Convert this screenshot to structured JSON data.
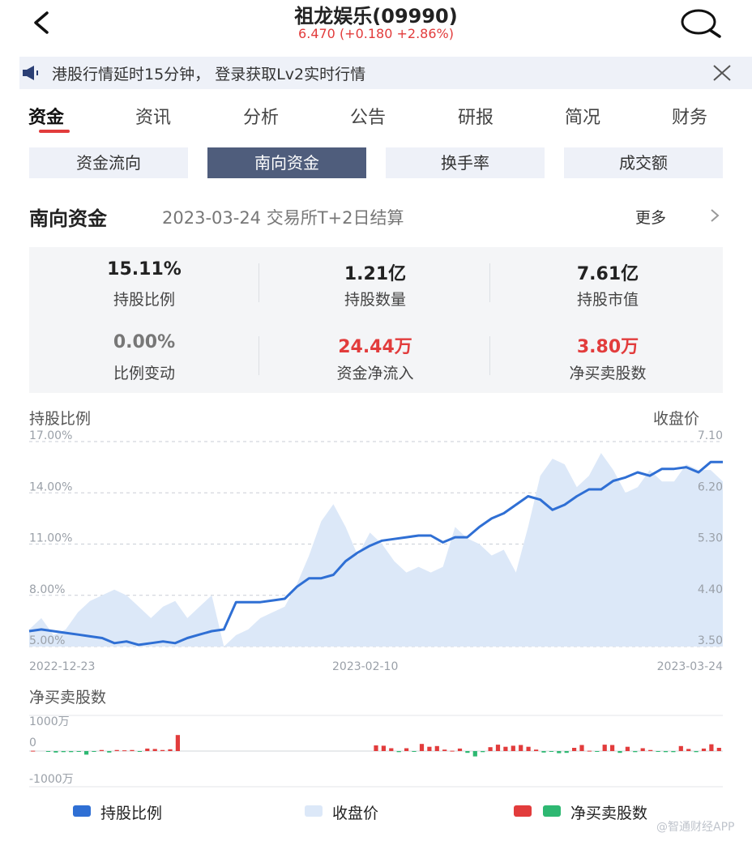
{
  "header": {
    "title": "祖龙娱乐(09990)",
    "quote": "6.470 (+0.180 +2.86%)"
  },
  "notice": {
    "text": "港股行情延时15分钟， 登录获取Lv2实时行情"
  },
  "tabs": [
    "资金",
    "资讯",
    "分析",
    "公告",
    "研报",
    "简况",
    "财务"
  ],
  "subtabs": [
    "资金流向",
    "南向资金",
    "换手率",
    "成交额"
  ],
  "section": {
    "title": "南向资金",
    "date": "2023-03-24 交易所T+2日结算",
    "more": "更多"
  },
  "stats": {
    "hold_ratio_value": "15.11%",
    "hold_ratio_label": "持股比例",
    "hold_qty_value": "1.21亿",
    "hold_qty_label": "持股数量",
    "hold_mv_value": "7.61亿",
    "hold_mv_label": "持股市值",
    "ratio_change_value": "0.00%",
    "ratio_change_label": "比例变动",
    "net_inflow_value": "24.44万",
    "net_inflow_label": "资金净流入",
    "net_shares_value": "3.80万",
    "net_shares_label": "净买卖股数"
  },
  "main_chart": {
    "left_title": "持股比例",
    "right_title": "收盘价",
    "left_ticks": [
      "17.00%",
      "14.00%",
      "11.00%",
      "8.00%",
      "5.00%"
    ],
    "right_ticks": [
      "7.10",
      "6.20",
      "5.30",
      "4.40",
      "3.50"
    ],
    "x_labels": [
      "2022-12-23",
      "2023-02-10",
      "2023-03-24"
    ]
  },
  "bar_chart": {
    "title": "净买卖股数",
    "y_ticks": [
      "1000万",
      "0",
      "-1000万"
    ]
  },
  "legend": {
    "hold_ratio": "持股比例",
    "close_price": "收盘价",
    "net_shares": "净买卖股数"
  },
  "watermark": "@智通财经APP",
  "colors": {
    "up": "#e23c3c",
    "down": "#2eb872",
    "line": "#2f6fd4",
    "area": "#dce8f8",
    "active_subtab": "#4f5d7c"
  },
  "chart_data": [
    {
      "type": "line",
      "title": "",
      "x_start": "2022-12-23",
      "x_end": "2023-03-24",
      "ylim_left": [
        5.0,
        17.0
      ],
      "ylim_right": [
        3.5,
        7.1
      ],
      "series": [
        {
          "name": "持股比例",
          "axis": "left",
          "values": [
            5.9,
            6.0,
            5.9,
            5.8,
            5.7,
            5.6,
            5.5,
            5.2,
            5.3,
            5.1,
            5.2,
            5.3,
            5.2,
            5.5,
            5.7,
            5.9,
            6.0,
            7.6,
            7.6,
            7.6,
            7.7,
            7.8,
            8.5,
            9.0,
            9.0,
            9.2,
            10.0,
            10.5,
            10.9,
            11.2,
            11.3,
            11.4,
            11.5,
            11.5,
            11.1,
            11.4,
            11.4,
            12.0,
            12.5,
            12.8,
            13.3,
            13.8,
            13.6,
            13.0,
            13.3,
            13.8,
            14.2,
            14.2,
            14.7,
            14.9,
            15.2,
            15.0,
            15.4,
            15.4,
            15.5,
            15.2,
            15.8,
            15.8
          ]
        },
        {
          "name": "收盘价",
          "axis": "right",
          "values": [
            3.8,
            4.0,
            3.7,
            3.8,
            4.1,
            4.3,
            4.4,
            4.5,
            4.4,
            4.2,
            4.0,
            4.2,
            4.3,
            4.0,
            4.2,
            4.4,
            3.5,
            3.7,
            3.8,
            4.0,
            4.1,
            4.2,
            4.6,
            5.1,
            5.7,
            6.0,
            5.6,
            5.1,
            5.5,
            5.3,
            5.0,
            4.8,
            4.9,
            4.8,
            4.9,
            5.6,
            5.4,
            5.3,
            5.1,
            5.2,
            4.8,
            5.6,
            6.5,
            6.8,
            6.7,
            6.3,
            6.5,
            6.9,
            6.6,
            6.2,
            6.3,
            6.6,
            6.4,
            6.4,
            6.7,
            6.6,
            6.6,
            6.4
          ]
        }
      ]
    },
    {
      "type": "bar",
      "title": "",
      "ylim": [
        -1000,
        1000
      ],
      "series": [
        {
          "name": "净买卖股数",
          "values": [
            10,
            0,
            -20,
            -40,
            -30,
            -30,
            -20,
            -100,
            -20,
            30,
            -40,
            30,
            20,
            30,
            -20,
            70,
            60,
            30,
            50,
            450,
            0,
            0,
            0,
            0,
            0,
            0,
            0,
            0,
            0,
            0,
            0,
            0,
            0,
            0,
            0,
            0,
            0,
            0,
            0,
            0,
            0,
            0,
            0,
            0,
            0,
            160,
            150,
            80,
            -30,
            80,
            -20,
            200,
            120,
            140,
            40,
            10,
            70,
            -50,
            -150,
            -30,
            110,
            180,
            120,
            150,
            170,
            120,
            40,
            -40,
            -20,
            -60,
            -50,
            90,
            170,
            10,
            -20,
            180,
            170,
            -50,
            120,
            -30,
            80,
            30,
            -10,
            -30,
            -30,
            140,
            60,
            -30,
            70,
            190,
            90
          ]
        }
      ]
    }
  ]
}
